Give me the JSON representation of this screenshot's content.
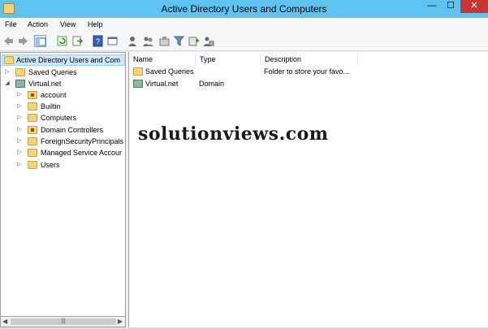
{
  "window": {
    "title": "Active Directory Users and Computers",
    "min_glyph": "—",
    "max_glyph": "☐",
    "close_glyph": "✕"
  },
  "menu": [
    "File",
    "Action",
    "View",
    "Help"
  ],
  "toolbar": {
    "icons": [
      "back-icon",
      "forward-icon",
      "console-tree-icon",
      "refresh-icon",
      "export-list-icon",
      "help-icon",
      "properties-icon",
      "new-user-icon",
      "new-group-icon",
      "new-ou-icon",
      "filter-icon",
      "add-to-group-icon",
      "delegate-icon"
    ]
  },
  "tree": {
    "root": "Active Directory Users and Com",
    "items": [
      {
        "label": "Saved Queries",
        "expander": "▷",
        "icon": "folder-icon"
      },
      {
        "label": "Virtual.net",
        "expander": "◢",
        "icon": "domain-icon"
      },
      {
        "label": "account",
        "expander": "▷",
        "icon": "ou-icon"
      },
      {
        "label": "Builtin",
        "expander": "▷",
        "icon": "folder-icon"
      },
      {
        "label": "Computers",
        "expander": "▷",
        "icon": "folder-icon"
      },
      {
        "label": "Domain Controllers",
        "expander": "▷",
        "icon": "ou-icon"
      },
      {
        "label": "ForeignSecurityPrincipals",
        "expander": "▷",
        "icon": "folder-icon"
      },
      {
        "label": "Managed Service Accour",
        "expander": "▷",
        "icon": "folder-icon"
      },
      {
        "label": "Users",
        "expander": "▷",
        "icon": "folder-icon"
      }
    ],
    "scroll_grip": "|||"
  },
  "list": {
    "columns": [
      "Name",
      "Type",
      "Description"
    ],
    "rows": [
      {
        "name": "Saved Queries",
        "type": "",
        "description": "Folder to store your favo...",
        "icon": "folder-icon"
      },
      {
        "name": "Virtual.net",
        "type": "Domain",
        "description": "",
        "icon": "domain-icon"
      }
    ]
  },
  "watermark": "solutionviews.com",
  "colors": {
    "titlebar": "#5fc3f0",
    "close": "#c7372f",
    "selection": "#cce8ff"
  }
}
